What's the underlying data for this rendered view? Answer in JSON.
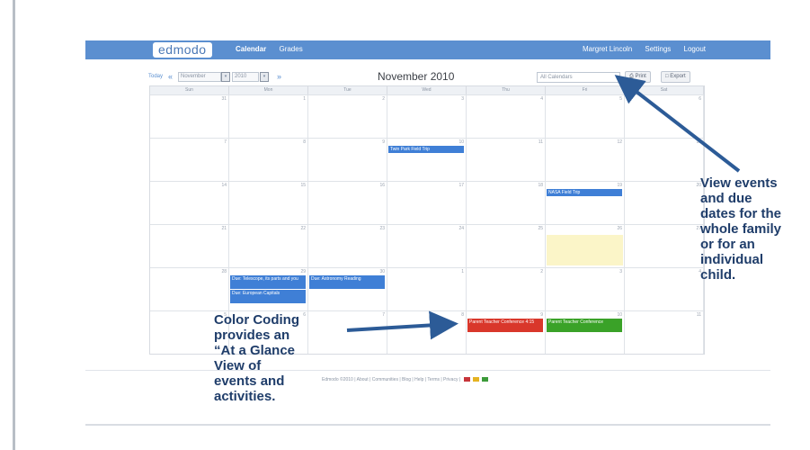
{
  "header": {
    "logo": "edmodo",
    "nav_left": [
      "Calendar",
      "Grades"
    ],
    "nav_right": [
      "Margret Lincoln",
      "Settings",
      "Logout"
    ]
  },
  "toolbar": {
    "today": "Today",
    "prev": "«",
    "month_select": "November",
    "year_select": "2010",
    "next": "»",
    "title": "November 2010",
    "calendar_filter": "All Calendars",
    "print": "Print",
    "export": "Export"
  },
  "calendar": {
    "days_of_week": [
      "Sun",
      "Mon",
      "Tue",
      "Wed",
      "Thu",
      "Fri",
      "Sat"
    ],
    "weeks": [
      [
        "31",
        "1",
        "2",
        "3",
        "4",
        "5",
        "6"
      ],
      [
        "7",
        "8",
        "9",
        "10",
        "11",
        "12",
        "13"
      ],
      [
        "14",
        "15",
        "16",
        "17",
        "18",
        "19",
        "20"
      ],
      [
        "21",
        "22",
        "23",
        "24",
        "25",
        "26",
        "27"
      ],
      [
        "28",
        "29",
        "30",
        "1",
        "2",
        "3",
        "4"
      ],
      [
        "5",
        "6",
        "7",
        "8",
        "9",
        "10",
        "11"
      ]
    ],
    "events": [
      {
        "label": "Twin Park Field Trip",
        "color": "#3f7fd6"
      },
      {
        "label": "NASA Field Trip",
        "color": "#3f7fd6"
      },
      {
        "label": "Due: Telescope, its parts and you",
        "color": "#3f7fd6"
      },
      {
        "label": "Due: European Capitals",
        "color": "#3f7fd6"
      },
      {
        "label": "Due: Astronomy Reading",
        "color": "#3f7fd6"
      },
      {
        "label": "Parent Teacher Conference 4:15",
        "color": "#d9372b"
      },
      {
        "label": "Parent Teacher Conference",
        "color": "#3aa228"
      }
    ],
    "highlight_color": "#fbf5c8"
  },
  "footer": {
    "text": "Edmodo ©2010 | About | Communities | Blog | Help | Terms | Privacy |"
  },
  "annotations": {
    "right": "View events\nand due\ndates for the\nwhole family\nor for an\nindividual\nchild.",
    "left": "Color Coding\nprovides an\n“At a Glance\nView of\nevents and\nactivities."
  }
}
